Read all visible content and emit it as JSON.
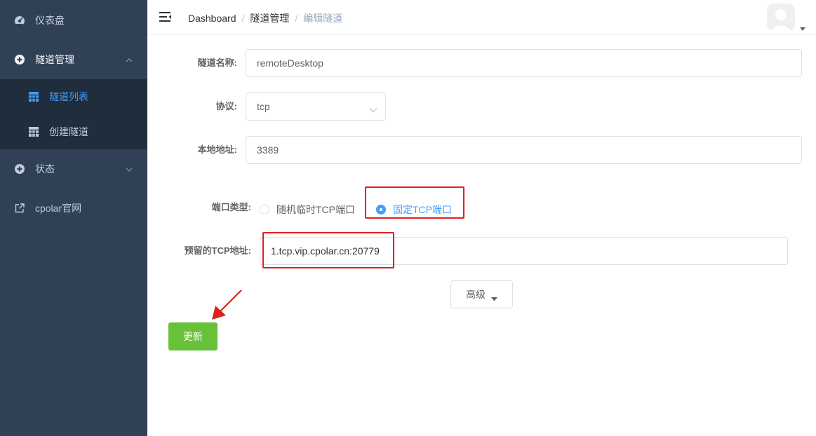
{
  "sidebar": {
    "items": [
      {
        "label": "仪表盘",
        "icon": "dashboard-icon"
      },
      {
        "label": "隧道管理",
        "icon": "tunnel-icon",
        "expanded": true,
        "children": [
          {
            "label": "隧道列表",
            "icon": "table-icon",
            "active": true
          },
          {
            "label": "创建隧道",
            "icon": "table-icon"
          }
        ]
      },
      {
        "label": "状态",
        "icon": "status-icon"
      },
      {
        "label": "cpolar官网",
        "icon": "external-link-icon"
      }
    ]
  },
  "breadcrumb": [
    "Dashboard",
    "隧道管理",
    "编辑隧道"
  ],
  "breadcrumb_separator": "/",
  "form": {
    "name_label": "隧道名称:",
    "name_value": "remoteDesktop",
    "protocol_label": "协议:",
    "protocol_value": "tcp",
    "local_label": "本地地址:",
    "local_value": "3389",
    "port_type_label": "端口类型:",
    "port_type_options": [
      {
        "label": "随机临时TCP端口",
        "checked": false
      },
      {
        "label": "固定TCP端口",
        "checked": true
      }
    ],
    "reserved_label": "预留的TCP地址:",
    "reserved_value": "1.tcp.vip.cpolar.cn:20779",
    "advanced_label": "高级",
    "update_label": "更新"
  },
  "colors": {
    "sidebar_bg": "#304156",
    "submenu_bg": "#1f2d3d",
    "accent": "#409eff",
    "success": "#67c23a",
    "annotation": "#e02020"
  }
}
